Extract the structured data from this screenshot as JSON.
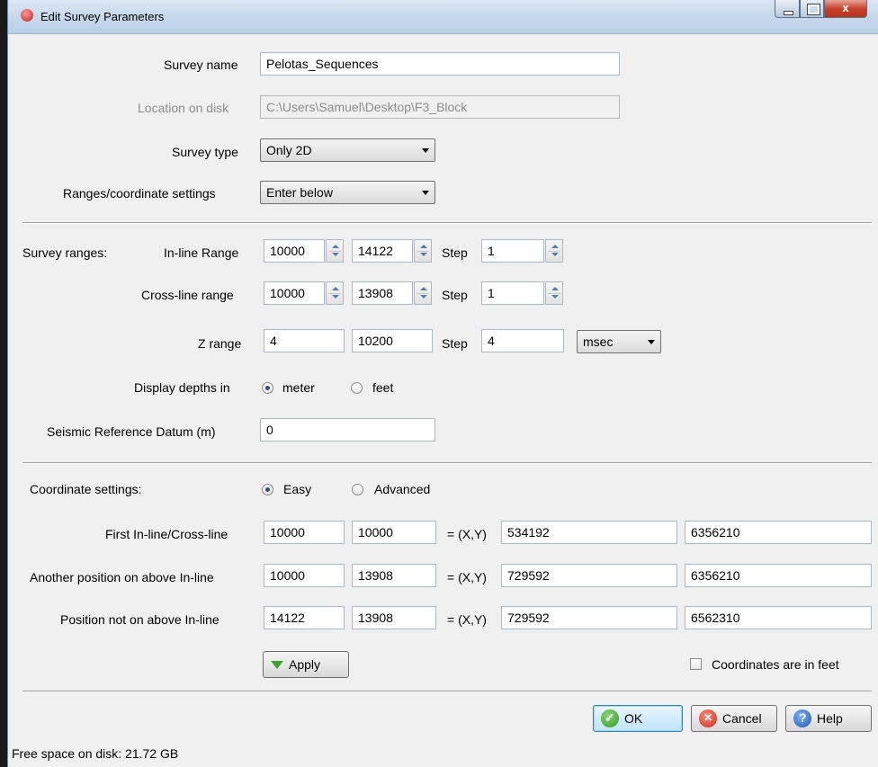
{
  "window": {
    "title": "Edit Survey Parameters",
    "close_glyph": "x",
    "icon": "survey-app-icon"
  },
  "survey_name": {
    "label": "Survey name",
    "value": "Pelotas_Sequences"
  },
  "location": {
    "label": "Location on disk",
    "value": "C:\\Users\\Samuel\\Desktop\\F3_Block"
  },
  "survey_type": {
    "label": "Survey type",
    "value": "Only 2D"
  },
  "ranges_setting": {
    "label": "Ranges/coordinate settings",
    "value": "Enter below"
  },
  "ranges": {
    "section_label": "Survey ranges:",
    "inline": {
      "label": "In-line Range",
      "start": "10000",
      "stop": "14122",
      "step_label": "Step",
      "step": "1"
    },
    "crossline": {
      "label": "Cross-line range",
      "start": "10000",
      "stop": "13908",
      "step_label": "Step",
      "step": "1"
    },
    "z": {
      "label": "Z range",
      "start": "4",
      "stop": "10200",
      "step_label": "Step",
      "step": "4",
      "unit": "msec"
    }
  },
  "depths": {
    "label": "Display depths in",
    "opt_meter": "meter",
    "opt_feet": "feet",
    "selected": "meter"
  },
  "datum": {
    "label": "Seismic Reference Datum (m)",
    "value": "0"
  },
  "coords": {
    "section_label": "Coordinate settings:",
    "opt_easy": "Easy",
    "opt_advanced": "Advanced",
    "selected": "Easy",
    "eq_label": "= (X,Y)",
    "rows": [
      {
        "label": "First In-line/Cross-line",
        "il": "10000",
        "xl": "10000",
        "x": "534192",
        "y": "6356210"
      },
      {
        "label": "Another position on above In-line",
        "il": "10000",
        "xl": "13908",
        "x": "729592",
        "y": "6356210"
      },
      {
        "label": "Position not on above In-line",
        "il": "14122",
        "xl": "13908",
        "x": "729592",
        "y": "6562310"
      }
    ],
    "apply_label": "Apply",
    "feet_check_label": "Coordinates are in feet",
    "feet_checked": false
  },
  "buttons": {
    "ok": "OK",
    "cancel": "Cancel",
    "help": "Help"
  },
  "status": {
    "free_space": "Free space on disk: 21.72 GB"
  }
}
